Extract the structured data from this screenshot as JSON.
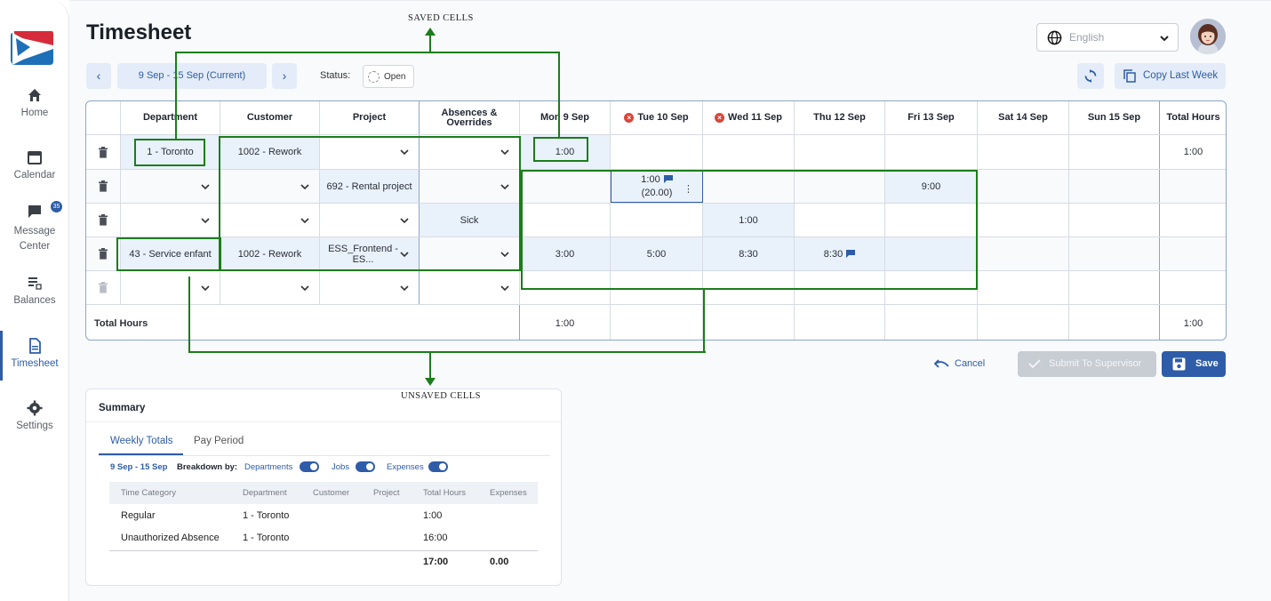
{
  "sidebar": {
    "items": [
      {
        "label": "Home"
      },
      {
        "label": "Calendar"
      },
      {
        "label": "Message Center",
        "badge": "35"
      },
      {
        "label": "Balances"
      },
      {
        "label": "Timesheet"
      },
      {
        "label": "Settings"
      }
    ]
  },
  "header": {
    "title": "Timesheet",
    "language": "English"
  },
  "toolbar": {
    "prev": "‹",
    "period": "9 Sep - 15 Sep (Current)",
    "next": "›",
    "status_label": "Status:",
    "status_value": "Open",
    "copy_last_week": "Copy Last Week"
  },
  "grid": {
    "headers": [
      "Department",
      "Customer",
      "Project",
      "Absences & Overrides",
      "Mon 9 Sep",
      "Tue 10 Sep",
      "Wed 11 Sep",
      "Thu 12 Sep",
      "Fri 13 Sep",
      "Sat 14 Sep",
      "Sun 15 Sep",
      "Total Hours"
    ],
    "rows": [
      {
        "department": "1 - Toronto",
        "customer": "1002 - Rework",
        "project": "",
        "absence": "",
        "mon": "1:00",
        "tue": "",
        "wed": "",
        "thu": "",
        "fri": "",
        "sat": "",
        "sun": "",
        "total": "1:00"
      },
      {
        "department": "",
        "customer": "",
        "project": "692 - Rental project",
        "absence": "",
        "mon": "",
        "tue": "1:00",
        "tue_sub": "(20.00)",
        "wed": "",
        "thu": "",
        "fri": "9:00",
        "sat": "",
        "sun": "",
        "total": ""
      },
      {
        "department": "",
        "customer": "",
        "project": "",
        "absence": "Sick",
        "mon": "",
        "tue": "",
        "wed": "1:00",
        "thu": "",
        "fri": "",
        "sat": "",
        "sun": "",
        "total": ""
      },
      {
        "department": "43 - Service enfant",
        "customer": "1002 - Rework",
        "project": "ESS_Frontend - ES...",
        "absence": "",
        "mon": "3:00",
        "tue": "5:00",
        "wed": "8:30",
        "thu": "8:30",
        "fri": "",
        "sat": "",
        "sun": "",
        "total": ""
      },
      {
        "department": "",
        "customer": "",
        "project": "",
        "absence": "",
        "mon": "",
        "tue": "",
        "wed": "",
        "thu": "",
        "fri": "",
        "sat": "",
        "sun": "",
        "total": ""
      }
    ],
    "totals": {
      "label": "Total Hours",
      "mon": "1:00",
      "total": "1:00"
    }
  },
  "annotations": {
    "saved": "SAVED CELLS",
    "unsaved": "UNSAVED CELLS"
  },
  "actions": {
    "cancel": "Cancel",
    "submit": "Submit To Supervisor",
    "save": "Save"
  },
  "summary": {
    "title": "Summary",
    "tabs": [
      "Weekly Totals",
      "Pay Period"
    ],
    "range": "9 Sep - 15 Sep",
    "breakdown_label": "Breakdown by:",
    "toggles": [
      "Departments",
      "Jobs",
      "Expenses"
    ],
    "columns": [
      "Time Category",
      "Department",
      "Customer",
      "Project",
      "Total Hours",
      "Expenses"
    ],
    "rows": [
      {
        "category": "Regular",
        "department": "1 - Toronto",
        "hours": "1:00"
      },
      {
        "category": "Unauthorized Absence",
        "department": "1 - Toronto",
        "hours": "16:00"
      }
    ],
    "total_hours": "17:00",
    "total_expenses": "0.00"
  },
  "colors": {
    "accent": "#2e5ca8",
    "annotation": "#1b7d1b",
    "error": "#d9463b"
  }
}
